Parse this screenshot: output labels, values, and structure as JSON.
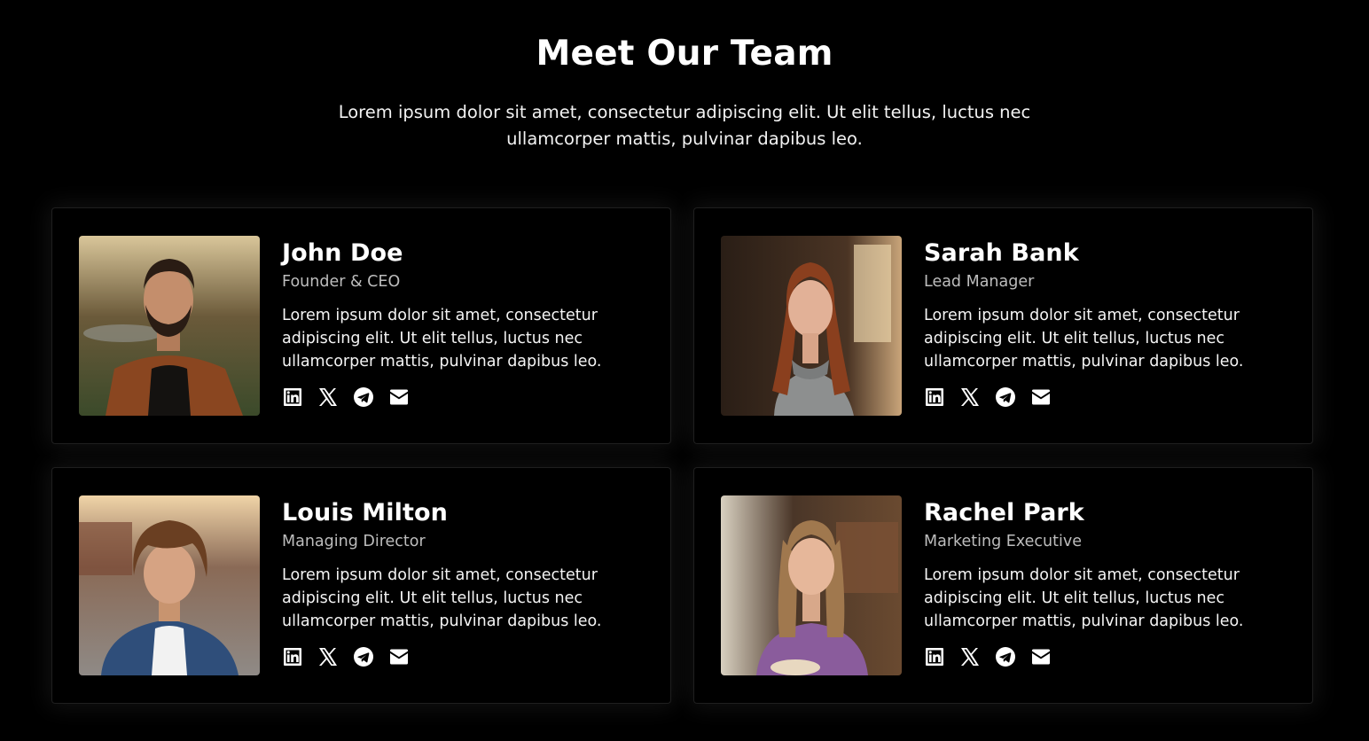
{
  "section": {
    "heading": "Meet Our Team",
    "intro_line1": "Lorem ipsum dolor sit amet, consectetur adipiscing elit. Ut elit tellus, luctus nec",
    "intro_line2": "ullamcorper mattis, pulvinar dapibus leo."
  },
  "team": [
    {
      "name": "John Doe",
      "role": "Founder & CEO",
      "bio": "Lorem ipsum dolor sit amet, consectetur adipiscing elit. Ut elit tellus, luctus nec ullamcorper mattis, pulvinar dapibus leo.",
      "photo_palette": {
        "bg": "#6b5a3a",
        "skin": "#c48e6c",
        "hair": "#2a1c14",
        "top": "#8a4620"
      }
    },
    {
      "name": "Sarah Bank",
      "role": "Lead Manager",
      "bio": "Lorem ipsum dolor sit amet, consectetur adipiscing elit. Ut elit tellus, luctus nec ullamcorper mattis, pulvinar dapibus leo.",
      "photo_palette": {
        "bg": "#3a2a1e",
        "skin": "#e2b197",
        "hair": "#8a3f1e",
        "top": "#8d8f8f"
      }
    },
    {
      "name": "Louis Milton",
      "role": "Managing Director",
      "bio": "Lorem ipsum dolor sit amet, consectetur adipiscing elit. Ut elit tellus, luctus nec ullamcorper mattis, pulvinar dapibus leo.",
      "photo_palette": {
        "bg": "#8a6a56",
        "skin": "#d6a383",
        "hair": "#6a3f22",
        "top": "#2f4e7a"
      }
    },
    {
      "name": "Rachel Park",
      "role": "Marketing Executive",
      "bio": "Lorem ipsum dolor sit amet, consectetur adipiscing elit. Ut elit tellus, luctus nec ullamcorper mattis, pulvinar dapibus leo.",
      "photo_palette": {
        "bg": "#4a3628",
        "skin": "#e6b79a",
        "hair": "#a0784e",
        "top": "#8a5c9c"
      }
    }
  ],
  "social_icons": [
    "linkedin-icon",
    "x-twitter-icon",
    "telegram-icon",
    "email-icon"
  ]
}
